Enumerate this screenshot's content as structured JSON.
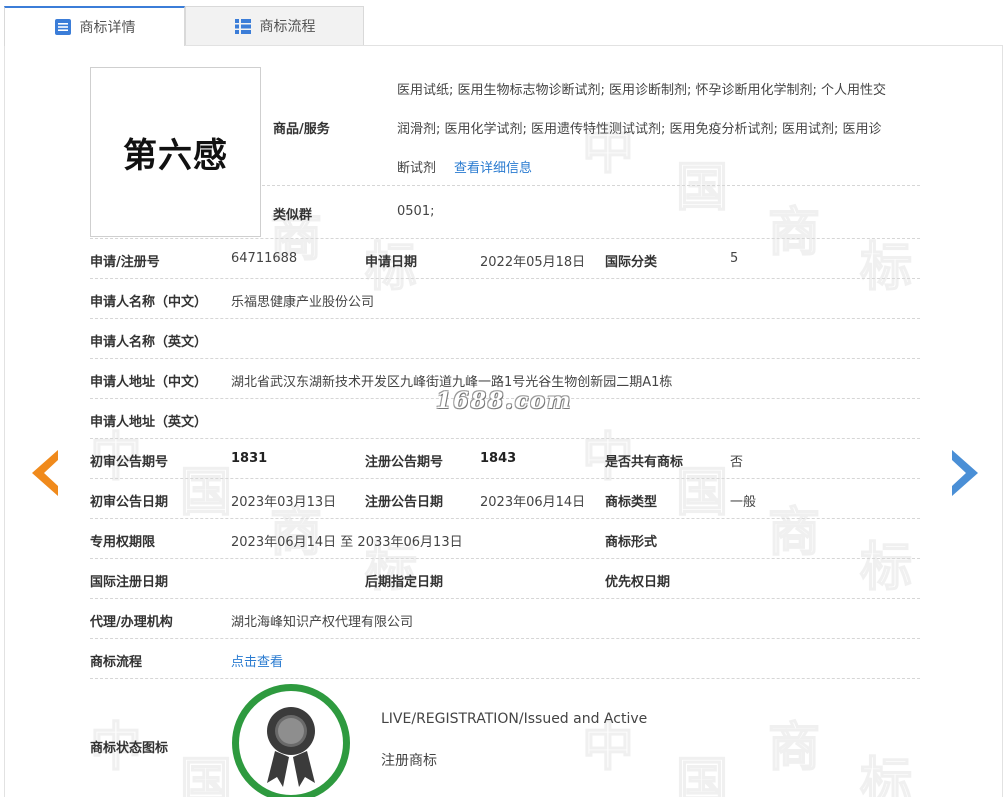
{
  "tabs": [
    {
      "label": "商标详情",
      "active": true
    },
    {
      "label": "商标流程",
      "active": false
    }
  ],
  "logo": {
    "text": "第六感"
  },
  "goods": {
    "label": "商品/服务",
    "lines": [
      "医用试纸; 医用生物标志物诊断试剂; 医用诊断制剂; 怀孕诊断用化学制剂; 个人用性交",
      "润滑剂; 医用化学试剂; 医用遗传特性测试试剂; 医用免疫分析试剂; 医用试剂; 医用诊",
      "断试剂"
    ],
    "detail_link": "查看详细信息"
  },
  "similar_group": {
    "label": "类似群",
    "value": "0501;"
  },
  "rows": {
    "reg_no": {
      "label": "申请/注册号",
      "value": "64711688"
    },
    "apply_date": {
      "label": "申请日期",
      "value": "2022年05月18日"
    },
    "intl_class": {
      "label": "国际分类",
      "value": "5"
    },
    "applicant_cn": {
      "label": "申请人名称（中文）",
      "value": "乐福思健康产业股份公司"
    },
    "applicant_en": {
      "label": "申请人名称（英文）",
      "value": ""
    },
    "address_cn": {
      "label": "申请人地址（中文）",
      "value": "湖北省武汉东湖新技术开发区九峰街道九峰一路1号光谷生物创新园二期A1栋"
    },
    "address_en": {
      "label": "申请人地址（英文）",
      "value": ""
    },
    "prelim_no": {
      "label": "初审公告期号",
      "value": "1831"
    },
    "reg_notice_no": {
      "label": "注册公告期号",
      "value": "1843"
    },
    "shared": {
      "label": "是否共有商标",
      "value": "否"
    },
    "prelim_date": {
      "label": "初审公告日期",
      "value": "2023年03月13日"
    },
    "reg_notice_date": {
      "label": "注册公告日期",
      "value": "2023年06月14日"
    },
    "tm_type": {
      "label": "商标类型",
      "value": "一般"
    },
    "exclusive_term": {
      "label": "专用权期限",
      "value": "2023年06月14日 至 2033年06月13日"
    },
    "tm_form": {
      "label": "商标形式",
      "value": ""
    },
    "intl_reg_date": {
      "label": "国际注册日期",
      "value": ""
    },
    "later_designation": {
      "label": "后期指定日期",
      "value": ""
    },
    "priority_date": {
      "label": "优先权日期",
      "value": ""
    },
    "agent": {
      "label": "代理/办理机构",
      "value": "湖北海峰知识产权代理有限公司"
    },
    "process": {
      "label": "商标流程",
      "value": "点击查看"
    }
  },
  "status": {
    "label": "商标状态图标",
    "en": "LIVE/REGISTRATION/Issued and Active",
    "cn": "注册商标",
    "ring_color": "#2e9a3f"
  },
  "watermark": {
    "site": "1688.com",
    "chars": [
      "中",
      "国",
      "商",
      "标"
    ]
  },
  "nav": {
    "prev_color": "#f08a1c",
    "next_color": "#4a8fd6",
    "prev_icon": "arrow-left-icon",
    "next_icon": "arrow-right-icon"
  }
}
